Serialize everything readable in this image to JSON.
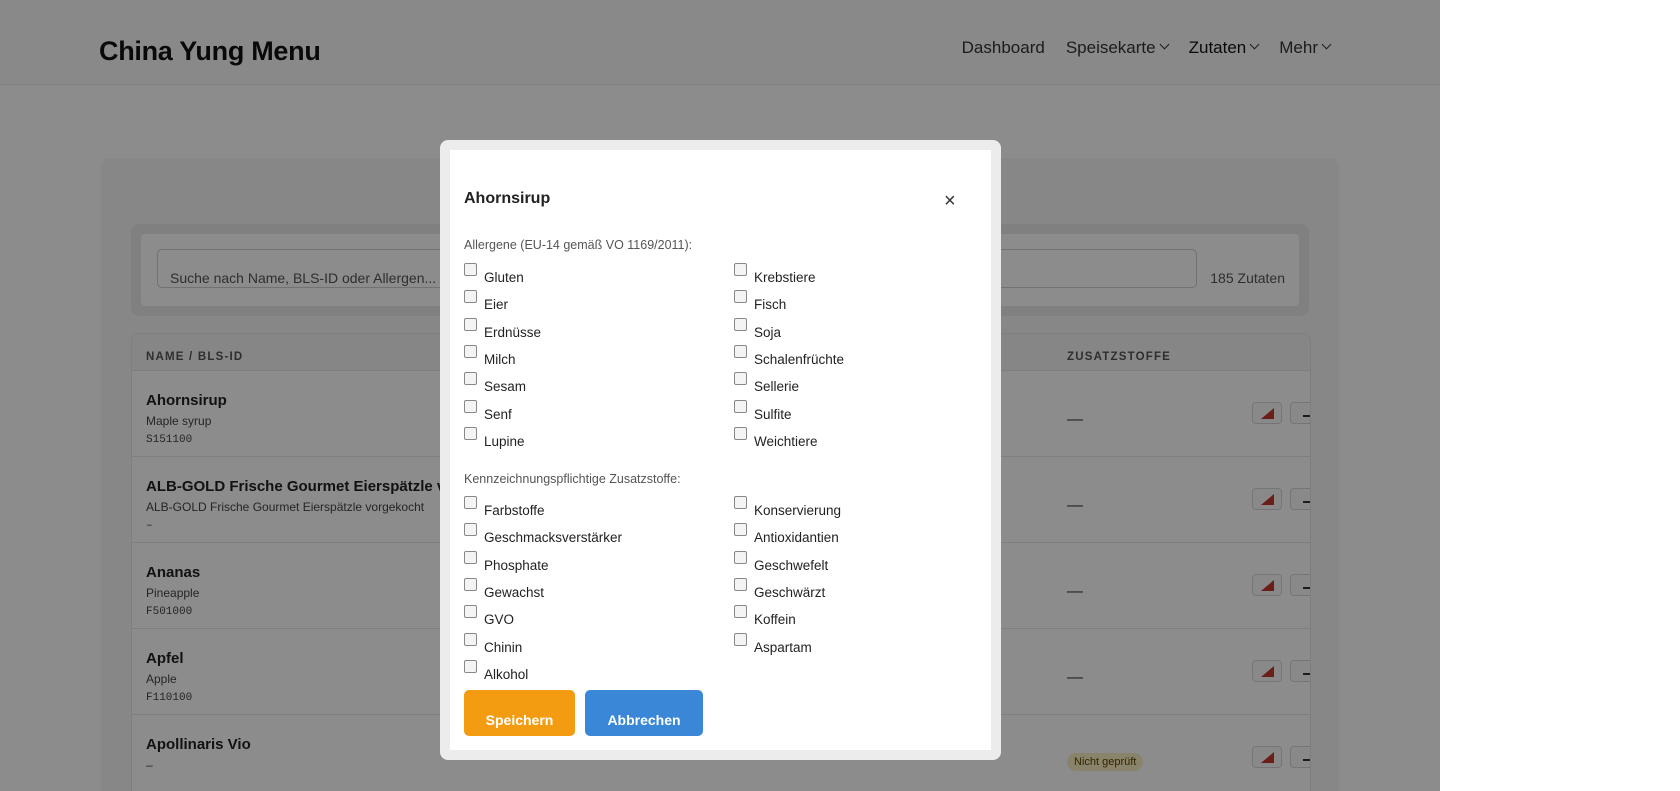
{
  "brand": "China Yung Menu",
  "nav": [
    {
      "label": "Dashboard",
      "dropdown": false
    },
    {
      "label": "Speisekarte",
      "dropdown": true
    },
    {
      "label": "Zutaten",
      "dropdown": true
    },
    {
      "label": "Mehr",
      "dropdown": true
    }
  ],
  "search": {
    "placeholder": "Suche nach Name, BLS-ID oder Allergen...",
    "count": "185 Zutaten"
  },
  "table": {
    "headers": {
      "name": "NAME / BLS-ID",
      "additives": "ZUSATZSTOFFE"
    },
    "rows": [
      {
        "name": "Ahornsirup",
        "sub": "Maple syrup",
        "id": "S151100",
        "additives": "—"
      },
      {
        "name": "ALB-GOLD Frische Gourmet Eierspätzle vorgekocht",
        "sub": "ALB-GOLD Frische Gourmet Eierspätzle vorgekocht",
        "id": "–",
        "additives": "—"
      },
      {
        "name": "Ananas",
        "sub": "Pineapple",
        "id": "F501000",
        "additives": "—"
      },
      {
        "name": "Apfel",
        "sub": "Apple",
        "id": "F110100",
        "additives": "—"
      },
      {
        "name": "Apollinaris Vio",
        "sub": "–",
        "id": "",
        "badge": "Nicht geprüft"
      }
    ]
  },
  "modal": {
    "title": "Ahornsirup",
    "close": "×",
    "allergens_label": "Allergene (EU-14 gemäß VO 1169/2011):",
    "allergens_left": [
      "Gluten",
      "Eier",
      "Erdnüsse",
      "Milch",
      "Sesam",
      "Senf",
      "Lupine"
    ],
    "allergens_right": [
      "Krebstiere",
      "Fisch",
      "Soja",
      "Schalenfrüchte",
      "Sellerie",
      "Sulfite",
      "Weichtiere"
    ],
    "additives_label": "Kennzeichnungspflichtige Zusatzstoffe:",
    "additives_left": [
      "Farbstoffe",
      "Geschmacksverstärker",
      "Phosphate",
      "Gewachst",
      "GVO",
      "Chinin",
      "Alkohol"
    ],
    "additives_right": [
      "Konservierung",
      "Antioxidantien",
      "Geschwefelt",
      "Geschwärzt",
      "Koffein",
      "Aspartam"
    ],
    "save": "Speichern",
    "cancel": "Abbrechen"
  },
  "colors": {
    "save": "#f39c12",
    "cancel": "#3a87d8",
    "action_icon": "#c0392b"
  }
}
